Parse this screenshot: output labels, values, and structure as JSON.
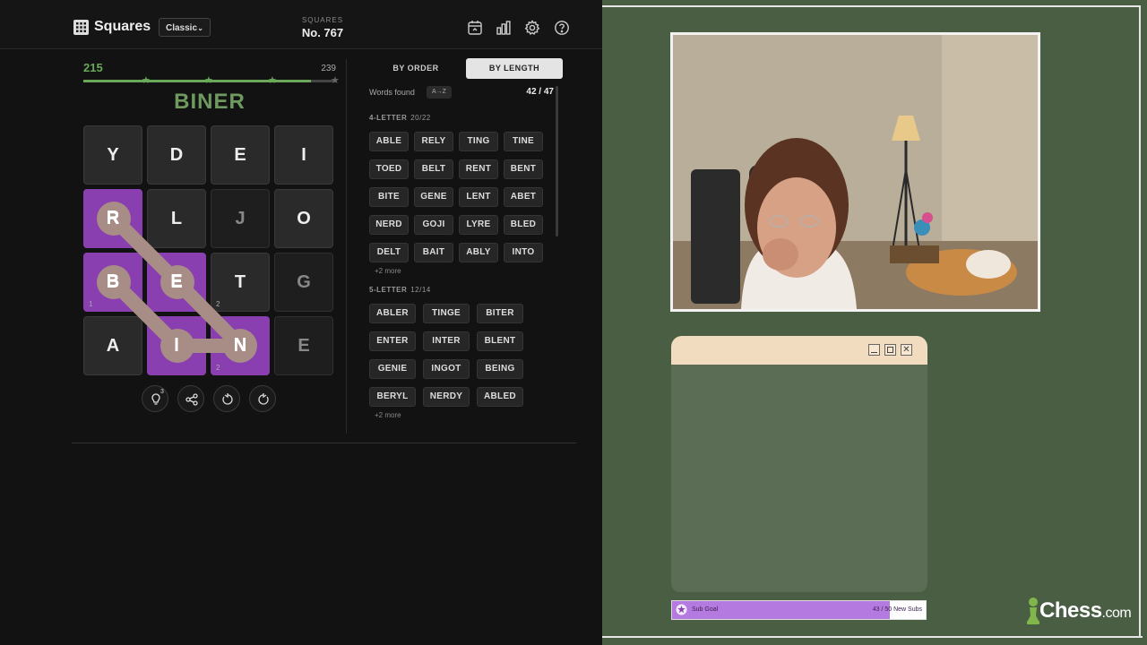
{
  "game": {
    "app_title": "Squares",
    "mode": "Classic",
    "puzzle_kicker": "SQUARES",
    "puzzle_number": "No. 767",
    "icons": [
      "calendar-icon",
      "stats-icon",
      "gear-icon",
      "help-icon"
    ],
    "score": "215",
    "max_score": "239",
    "score_progress": 0.9,
    "current_word": "BINER",
    "board": [
      {
        "letter": "Y",
        "state": "active",
        "sub": ""
      },
      {
        "letter": "D",
        "state": "active",
        "sub": ""
      },
      {
        "letter": "E",
        "state": "active",
        "sub": ""
      },
      {
        "letter": "I",
        "state": "active",
        "sub": ""
      },
      {
        "letter": "R",
        "state": "selected",
        "sub": ""
      },
      {
        "letter": "L",
        "state": "active",
        "sub": ""
      },
      {
        "letter": "J",
        "state": "dim",
        "sub": ""
      },
      {
        "letter": "O",
        "state": "active",
        "sub": ""
      },
      {
        "letter": "B",
        "state": "selected",
        "sub": "1"
      },
      {
        "letter": "E",
        "state": "selected",
        "sub": ""
      },
      {
        "letter": "T",
        "state": "active",
        "sub": "2"
      },
      {
        "letter": "G",
        "state": "dim",
        "sub": ""
      },
      {
        "letter": "A",
        "state": "active",
        "sub": ""
      },
      {
        "letter": "I",
        "state": "selected",
        "sub": ""
      },
      {
        "letter": "N",
        "state": "selected",
        "sub": "2"
      },
      {
        "letter": "E",
        "state": "dim",
        "sub": ""
      }
    ],
    "hint_count": "3",
    "tools": [
      "hint-icon",
      "share-icon",
      "undo-icon",
      "redo-icon"
    ]
  },
  "words": {
    "tab_order": "BY ORDER",
    "tab_length": "BY LENGTH",
    "found_label": "Words found",
    "sort_label": "A→Z",
    "found_count": "42 / 47",
    "groups": [
      {
        "title": "4-LETTER",
        "count": "20/22",
        "words": [
          "ABLE",
          "RELY",
          "TING",
          "TINE",
          "TOED",
          "BELT",
          "RENT",
          "BENT",
          "BITE",
          "GENE",
          "LENT",
          "ABET",
          "NERD",
          "GOJI",
          "LYRE",
          "BLED",
          "DELT",
          "BAIT",
          "ABLY",
          "INTO"
        ],
        "more": "+2 more"
      },
      {
        "title": "5-LETTER",
        "count": "12/14",
        "words": [
          "ABLER",
          "TINGE",
          "BITER",
          "ENTER",
          "INTER",
          "BLENT",
          "GENIE",
          "INGOT",
          "BEING",
          "BERYL",
          "NERDY",
          "ABLED"
        ],
        "more": "+2 more"
      }
    ]
  },
  "stream": {
    "subgoal_label": "Sub Goal",
    "subgoal_progress": "43 / 50 New Subs",
    "subgoal_fraction": 0.86,
    "brand": "Chess",
    "brand_suffix": ".com",
    "colors": {
      "green_bg": "#4a5e44",
      "purple": "#8a3fb0",
      "goal_purple": "#b57ae0"
    }
  }
}
